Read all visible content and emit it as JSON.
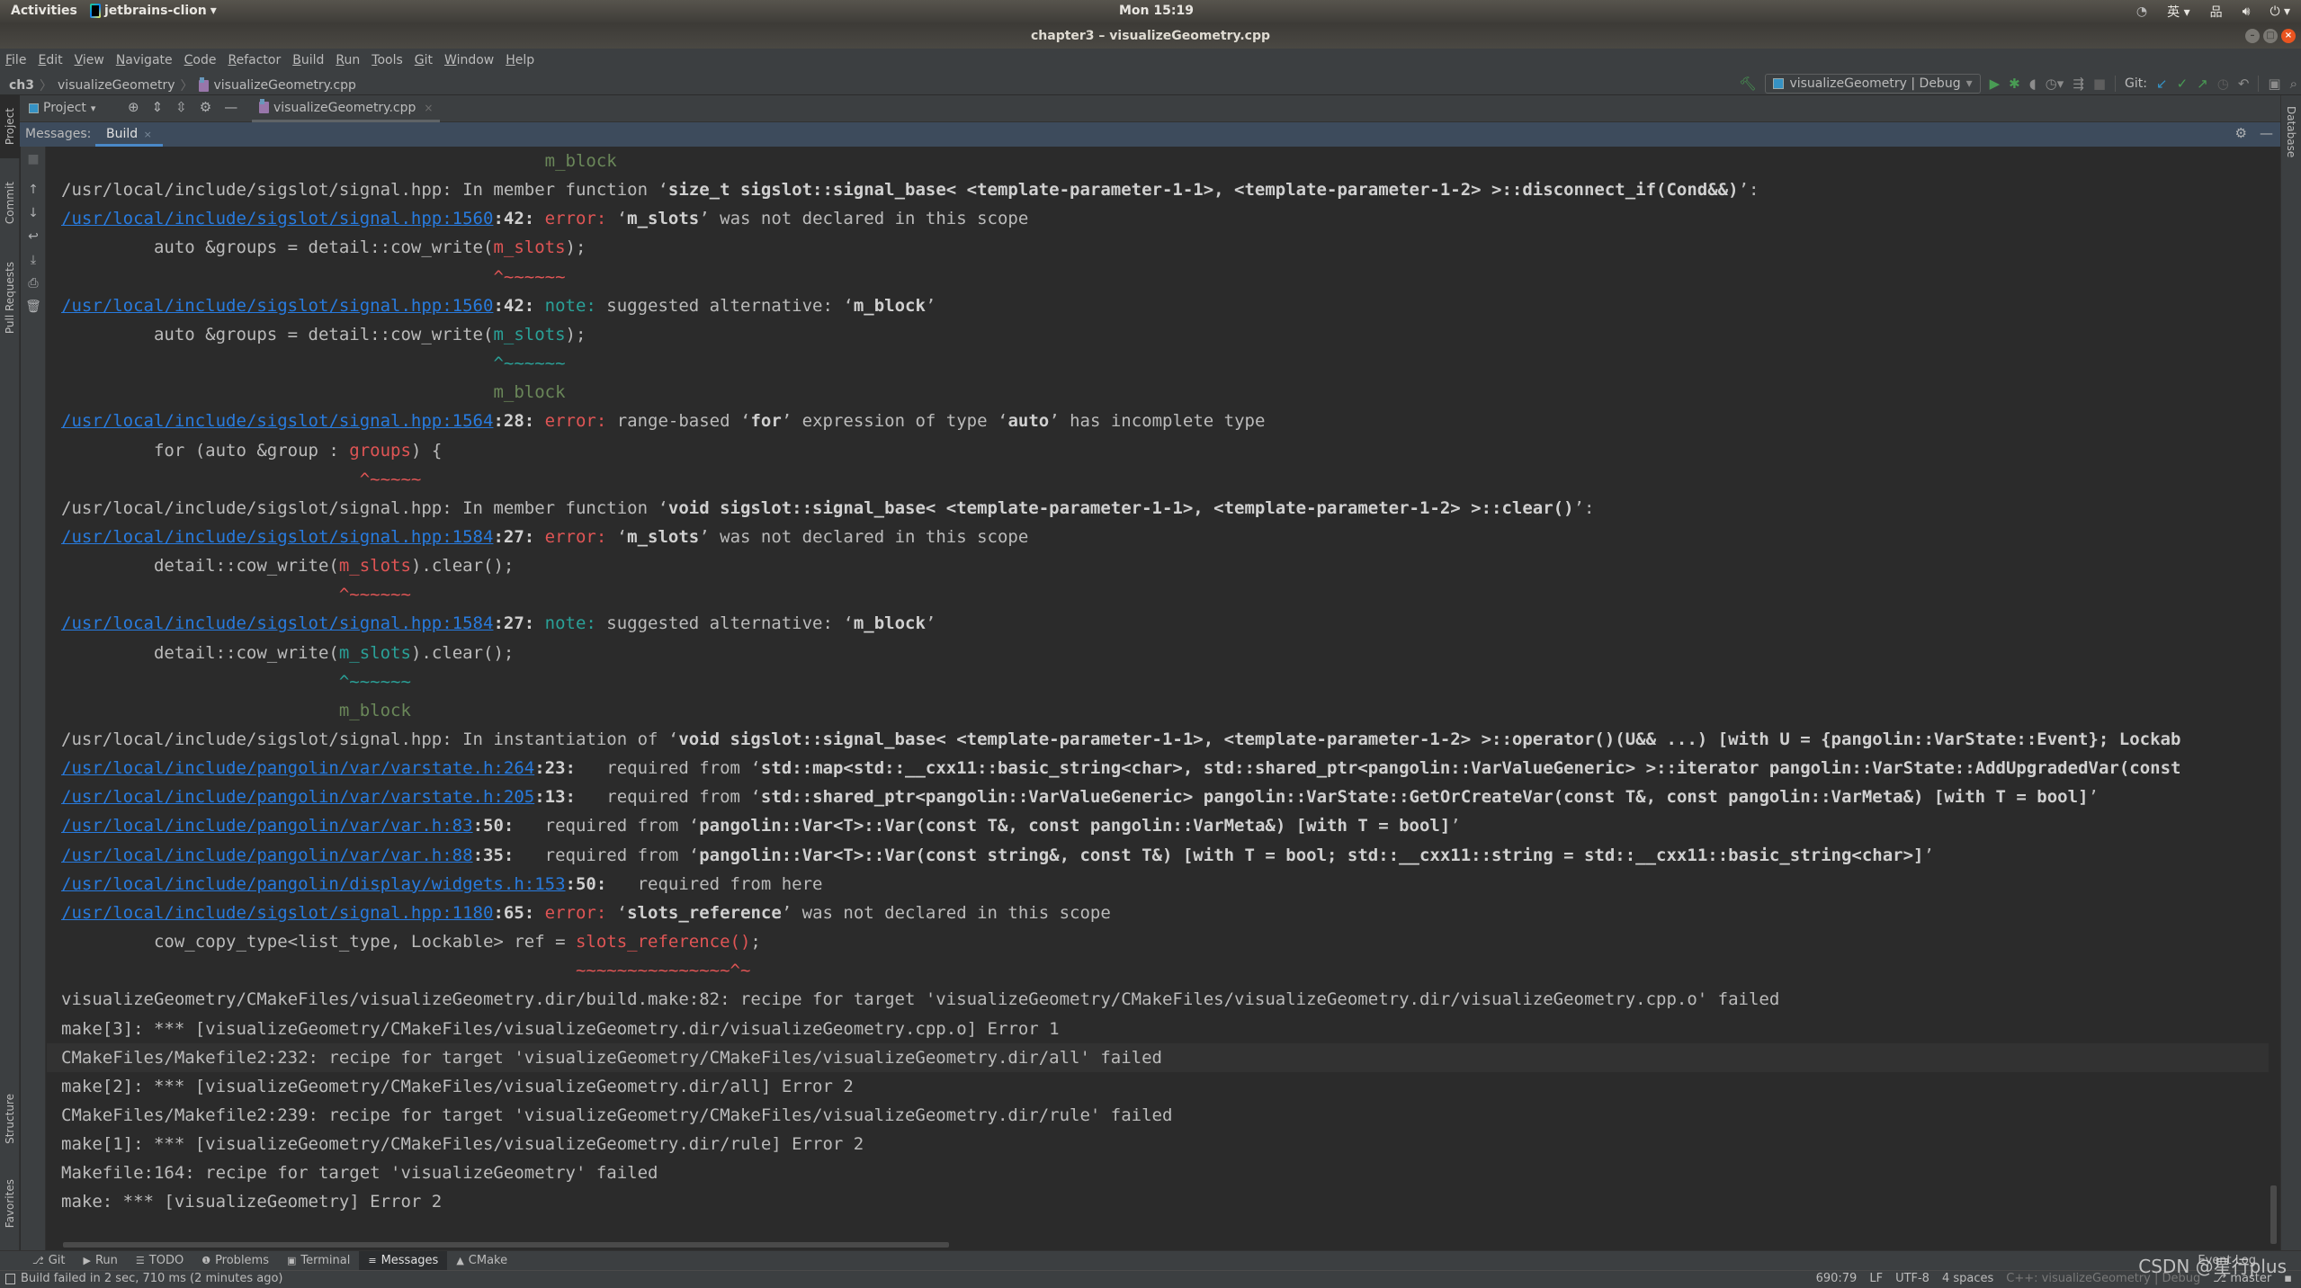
{
  "gnome": {
    "activities": "Activities",
    "app_name": "jetbrains-clion",
    "clock": "Mon 15:19",
    "input_method": "英"
  },
  "window": {
    "title": "chapter3 – visualizeGeometry.cpp"
  },
  "menu": [
    "File",
    "Edit",
    "View",
    "Navigate",
    "Code",
    "Refactor",
    "Build",
    "Run",
    "Tools",
    "Git",
    "Window",
    "Help"
  ],
  "breadcrumb": {
    "root": "ch3",
    "folder": "visualizeGeometry",
    "file": "visualizeGeometry.cpp"
  },
  "toolbar": {
    "run_config": "visualizeGeometry | Debug",
    "git_label": "Git:"
  },
  "tab_row": {
    "project_label": "Project",
    "editor_tab": "visualizeGeometry.cpp"
  },
  "left_tool_windows": [
    "Project",
    "Commit",
    "Pull Requests",
    "Structure",
    "Favorites"
  ],
  "right_tool_windows": [
    "Database"
  ],
  "messages": {
    "label": "Messages:",
    "tab": "Build"
  },
  "output_lines": [
    {
      "indent": "                                               ",
      "parts": [
        {
          "t": "m_block",
          "c": "sugg"
        }
      ]
    },
    {
      "parts": [
        {
          "t": "/usr/local/include/sigslot/signal.hpp: In member function ‘",
          "c": ""
        },
        {
          "t": "size_t sigslot::signal_base< <template-parameter-1-1>, <template-parameter-1-2> >::disconnect_if(Cond&&)",
          "c": "bold"
        },
        {
          "t": "’:",
          "c": ""
        }
      ]
    },
    {
      "parts": [
        {
          "t": "/usr/local/include/sigslot/signal.hpp:1560",
          "c": "link"
        },
        {
          "t": ":42: ",
          "c": "bold"
        },
        {
          "t": "error:",
          "c": "err"
        },
        {
          "t": " ‘",
          "c": ""
        },
        {
          "t": "m_slots",
          "c": "bold"
        },
        {
          "t": "’ was not declared in this scope",
          "c": ""
        }
      ]
    },
    {
      "parts": [
        {
          "t": "         auto &groups = detail::cow_write(",
          "c": ""
        },
        {
          "t": "m_slots",
          "c": "err"
        },
        {
          "t": ");",
          "c": ""
        }
      ]
    },
    {
      "parts": [
        {
          "t": "                                          ",
          "c": ""
        },
        {
          "t": "^~~~~~~",
          "c": "caret-red"
        }
      ]
    },
    {
      "parts": [
        {
          "t": "/usr/local/include/sigslot/signal.hpp:1560",
          "c": "link"
        },
        {
          "t": ":42: ",
          "c": "bold"
        },
        {
          "t": "note:",
          "c": "note"
        },
        {
          "t": " suggested alternative: ‘",
          "c": ""
        },
        {
          "t": "m_block",
          "c": "bold"
        },
        {
          "t": "’",
          "c": ""
        }
      ]
    },
    {
      "parts": [
        {
          "t": "         auto &groups = detail::cow_write(",
          "c": ""
        },
        {
          "t": "m_slots",
          "c": "note"
        },
        {
          "t": ");",
          "c": ""
        }
      ]
    },
    {
      "parts": [
        {
          "t": "                                          ",
          "c": ""
        },
        {
          "t": "^~~~~~~",
          "c": "caret-teal"
        }
      ]
    },
    {
      "parts": [
        {
          "t": "                                          ",
          "c": ""
        },
        {
          "t": "m_block",
          "c": "sugg"
        }
      ]
    },
    {
      "parts": [
        {
          "t": "/usr/local/include/sigslot/signal.hpp:1564",
          "c": "link"
        },
        {
          "t": ":28: ",
          "c": "bold"
        },
        {
          "t": "error:",
          "c": "err"
        },
        {
          "t": " range-based ‘",
          "c": ""
        },
        {
          "t": "for",
          "c": "bold"
        },
        {
          "t": "’ expression of type ‘",
          "c": ""
        },
        {
          "t": "auto",
          "c": "bold"
        },
        {
          "t": "’ has incomplete type",
          "c": ""
        }
      ]
    },
    {
      "parts": [
        {
          "t": "         for (auto &group : ",
          "c": ""
        },
        {
          "t": "groups",
          "c": "err"
        },
        {
          "t": ") {",
          "c": ""
        }
      ]
    },
    {
      "parts": [
        {
          "t": "                             ",
          "c": ""
        },
        {
          "t": "^~~~~~",
          "c": "caret-red"
        }
      ]
    },
    {
      "parts": [
        {
          "t": "/usr/local/include/sigslot/signal.hpp: In member function ‘",
          "c": ""
        },
        {
          "t": "void sigslot::signal_base< <template-parameter-1-1>, <template-parameter-1-2> >::clear()",
          "c": "bold"
        },
        {
          "t": "’:",
          "c": ""
        }
      ]
    },
    {
      "parts": [
        {
          "t": "/usr/local/include/sigslot/signal.hpp:1584",
          "c": "link"
        },
        {
          "t": ":27: ",
          "c": "bold"
        },
        {
          "t": "error:",
          "c": "err"
        },
        {
          "t": " ‘",
          "c": ""
        },
        {
          "t": "m_slots",
          "c": "bold"
        },
        {
          "t": "’ was not declared in this scope",
          "c": ""
        }
      ]
    },
    {
      "parts": [
        {
          "t": "         detail::cow_write(",
          "c": ""
        },
        {
          "t": "m_slots",
          "c": "err"
        },
        {
          "t": ").clear();",
          "c": ""
        }
      ]
    },
    {
      "parts": [
        {
          "t": "                           ",
          "c": ""
        },
        {
          "t": "^~~~~~~",
          "c": "caret-red"
        }
      ]
    },
    {
      "parts": [
        {
          "t": "/usr/local/include/sigslot/signal.hpp:1584",
          "c": "link"
        },
        {
          "t": ":27: ",
          "c": "bold"
        },
        {
          "t": "note:",
          "c": "note"
        },
        {
          "t": " suggested alternative: ‘",
          "c": ""
        },
        {
          "t": "m_block",
          "c": "bold"
        },
        {
          "t": "’",
          "c": ""
        }
      ]
    },
    {
      "parts": [
        {
          "t": "         detail::cow_write(",
          "c": ""
        },
        {
          "t": "m_slots",
          "c": "note"
        },
        {
          "t": ").clear();",
          "c": ""
        }
      ]
    },
    {
      "parts": [
        {
          "t": "                           ",
          "c": ""
        },
        {
          "t": "^~~~~~~",
          "c": "caret-teal"
        }
      ]
    },
    {
      "parts": [
        {
          "t": "                           ",
          "c": ""
        },
        {
          "t": "m_block",
          "c": "sugg"
        }
      ]
    },
    {
      "parts": [
        {
          "t": "/usr/local/include/sigslot/signal.hpp: In instantiation of ‘",
          "c": ""
        },
        {
          "t": "void sigslot::signal_base< <template-parameter-1-1>, <template-parameter-1-2> >::operator()(U&& ...) [with U = {pangolin::VarState::Event}; Lockab",
          "c": "bold"
        }
      ]
    },
    {
      "parts": [
        {
          "t": "/usr/local/include/pangolin/var/varstate.h:264",
          "c": "link"
        },
        {
          "t": ":23:",
          "c": "bold"
        },
        {
          "t": "   required from ‘",
          "c": ""
        },
        {
          "t": "std::map<std::__cxx11::basic_string<char>, std::shared_ptr<pangolin::VarValueGeneric> >::iterator pangolin::VarState::AddUpgradedVar(const",
          "c": "bold"
        }
      ]
    },
    {
      "parts": [
        {
          "t": "/usr/local/include/pangolin/var/varstate.h:205",
          "c": "link"
        },
        {
          "t": ":13:",
          "c": "bold"
        },
        {
          "t": "   required from ‘",
          "c": ""
        },
        {
          "t": "std::shared_ptr<pangolin::VarValueGeneric> pangolin::VarState::GetOrCreateVar(const T&, const pangolin::VarMeta&) [with T = bool]",
          "c": "bold"
        },
        {
          "t": "’",
          "c": ""
        }
      ]
    },
    {
      "parts": [
        {
          "t": "/usr/local/include/pangolin/var/var.h:83",
          "c": "link"
        },
        {
          "t": ":50:",
          "c": "bold"
        },
        {
          "t": "   required from ‘",
          "c": ""
        },
        {
          "t": "pangolin::Var<T>::Var(const T&, const pangolin::VarMeta&) [with T = bool]",
          "c": "bold"
        },
        {
          "t": "’",
          "c": ""
        }
      ]
    },
    {
      "parts": [
        {
          "t": "/usr/local/include/pangolin/var/var.h:88",
          "c": "link"
        },
        {
          "t": ":35:",
          "c": "bold"
        },
        {
          "t": "   required from ‘",
          "c": ""
        },
        {
          "t": "pangolin::Var<T>::Var(const string&, const T&) [with T = bool; std::__cxx11::string = std::__cxx11::basic_string<char>]",
          "c": "bold"
        },
        {
          "t": "’",
          "c": ""
        }
      ]
    },
    {
      "parts": [
        {
          "t": "/usr/local/include/pangolin/display/widgets.h:153",
          "c": "link"
        },
        {
          "t": ":50:",
          "c": "bold"
        },
        {
          "t": "   required from here",
          "c": ""
        }
      ]
    },
    {
      "parts": [
        {
          "t": "/usr/local/include/sigslot/signal.hpp:1180",
          "c": "link"
        },
        {
          "t": ":65: ",
          "c": "bold"
        },
        {
          "t": "error:",
          "c": "err"
        },
        {
          "t": " ‘",
          "c": ""
        },
        {
          "t": "slots_reference",
          "c": "bold"
        },
        {
          "t": "’ was not declared in this scope",
          "c": ""
        }
      ]
    },
    {
      "parts": [
        {
          "t": "         cow_copy_type<list_type, Lockable> ref = ",
          "c": ""
        },
        {
          "t": "slots_reference()",
          "c": "err"
        },
        {
          "t": ";",
          "c": ""
        }
      ]
    },
    {
      "parts": [
        {
          "t": "                                                  ",
          "c": ""
        },
        {
          "t": "~~~~~~~~~~~~~~~^~",
          "c": "caret-red"
        }
      ]
    },
    {
      "parts": [
        {
          "t": "visualizeGeometry/CMakeFiles/visualizeGeometry.dir/build.make:82: recipe for target 'visualizeGeometry/CMakeFiles/visualizeGeometry.dir/visualizeGeometry.cpp.o' failed",
          "c": ""
        }
      ]
    },
    {
      "parts": [
        {
          "t": "make[3]: *** [visualizeGeometry/CMakeFiles/visualizeGeometry.dir/visualizeGeometry.cpp.o] Error 1",
          "c": ""
        }
      ]
    },
    {
      "highlight": true,
      "parts": [
        {
          "t": "CMakeFiles/Makefile2:232: recipe for target 'visualizeGeometry/CMakeFiles/visualizeGeometry.dir/all' failed",
          "c": ""
        }
      ]
    },
    {
      "parts": [
        {
          "t": "make[2]: *** [visualizeGeometry/CMakeFiles/visualizeGeometry.dir/all] Error 2",
          "c": ""
        }
      ]
    },
    {
      "parts": [
        {
          "t": "CMakeFiles/Makefile2:239: recipe for target 'visualizeGeometry/CMakeFiles/visualizeGeometry.dir/rule' failed",
          "c": ""
        }
      ]
    },
    {
      "parts": [
        {
          "t": "make[1]: *** [visualizeGeometry/CMakeFiles/visualizeGeometry.dir/rule] Error 2",
          "c": ""
        }
      ]
    },
    {
      "parts": [
        {
          "t": "Makefile:164: recipe for target 'visualizeGeometry' failed",
          "c": ""
        }
      ]
    },
    {
      "parts": [
        {
          "t": "make: *** [visualizeGeometry] Error 2",
          "c": ""
        }
      ]
    }
  ],
  "bottom_tabs": [
    {
      "icon": "git-icon",
      "glyph": "⎇",
      "label": "Git"
    },
    {
      "icon": "run-icon",
      "glyph": "▶",
      "label": "Run"
    },
    {
      "icon": "todo-icon",
      "glyph": "☰",
      "label": "TODO"
    },
    {
      "icon": "problems-icon",
      "glyph": "❶",
      "label": "Problems"
    },
    {
      "icon": "terminal-icon",
      "glyph": "▣",
      "label": "Terminal"
    },
    {
      "icon": "messages-icon",
      "glyph": "≡",
      "label": "Messages",
      "active": true
    },
    {
      "icon": "cmake-icon",
      "glyph": "▲",
      "label": "CMake"
    }
  ],
  "event_log": "Event Log",
  "status": {
    "message": "Build failed in 2 sec, 710 ms (2 minutes ago)",
    "position": "690:79",
    "line_ending": "LF",
    "encoding": "UTF-8",
    "indent": "4 spaces",
    "context": "C++: visualizeGeometry | Debug",
    "branch": "master"
  },
  "watermark": "CSDN @星行plus",
  "colors": {
    "error": "#e05555",
    "note": "#2aa198",
    "link": "#287bde",
    "suggestion": "#6a8759",
    "accent": "#4a88c7"
  }
}
